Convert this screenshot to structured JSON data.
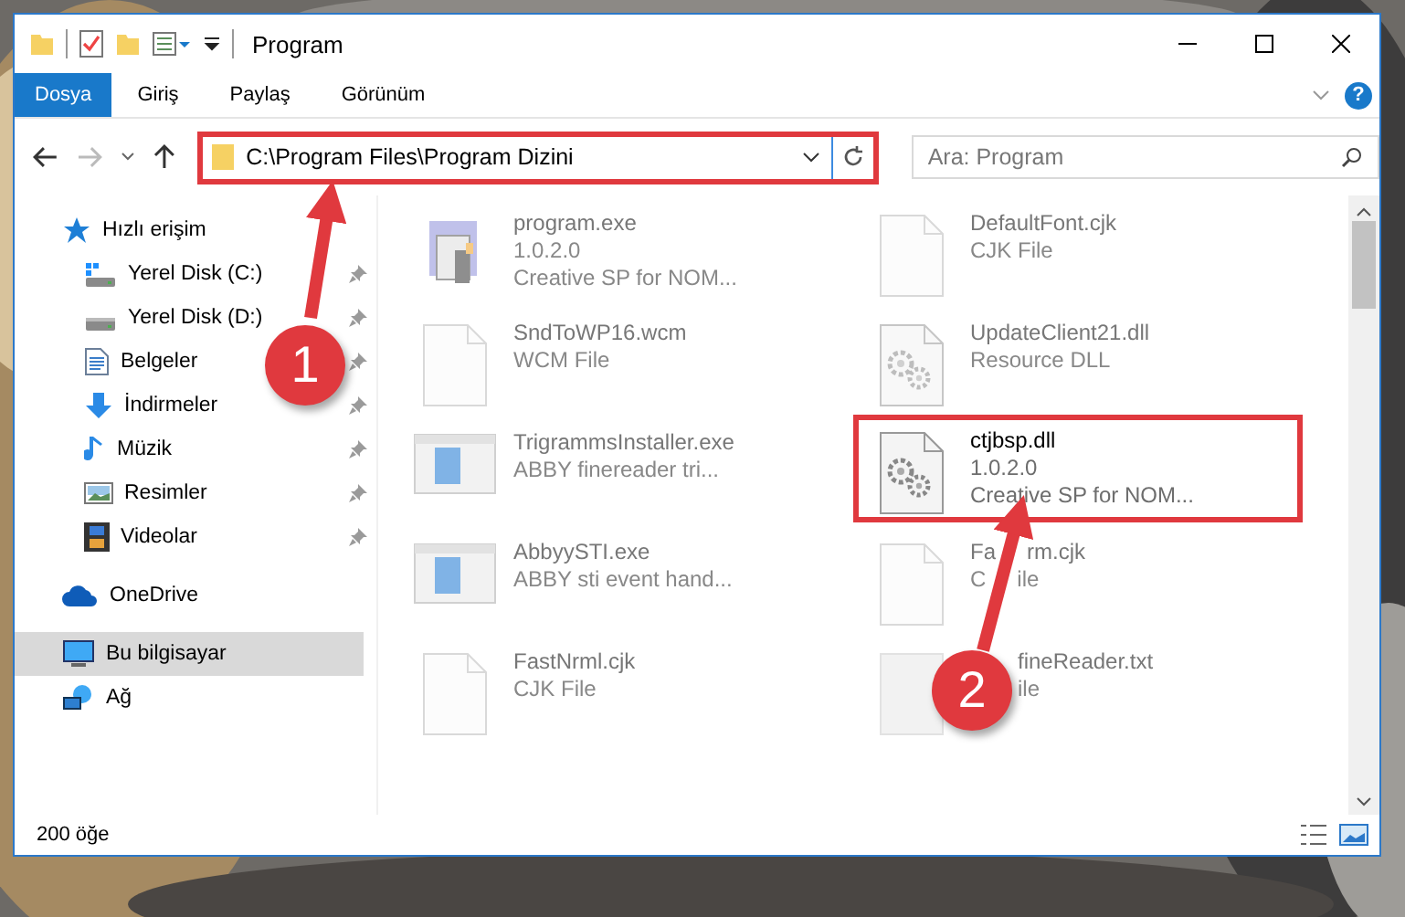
{
  "window": {
    "title": "Program"
  },
  "ribbon_tabs": [
    {
      "label": "Dosya",
      "selected": true
    },
    {
      "label": "Giriş",
      "selected": false
    },
    {
      "label": "Paylaş",
      "selected": false
    },
    {
      "label": "Görünüm",
      "selected": false
    }
  ],
  "help": "?",
  "address": {
    "value": "C:\\Program Files\\Program Dizini",
    "highlighted": true
  },
  "search": {
    "placeholder": "Ara: Program"
  },
  "sidebar": {
    "items": [
      {
        "label": "Hızlı erişim",
        "kind": "star",
        "selected": false,
        "children": [
          {
            "label": "Yerel Disk (C:)",
            "kind": "drive-c",
            "selected": false,
            "pinned": true
          },
          {
            "label": "Yerel Disk (D:)",
            "kind": "drive",
            "selected": false,
            "pinned": true
          },
          {
            "label": "Belgeler",
            "kind": "document",
            "selected": false,
            "pinned": true
          },
          {
            "label": "İndirmeler",
            "kind": "download",
            "selected": false,
            "pinned": true
          },
          {
            "label": "Müzik",
            "kind": "music",
            "selected": false,
            "pinned": true
          },
          {
            "label": "Resimler",
            "kind": "pictures",
            "selected": false,
            "pinned": true
          },
          {
            "label": "Videolar",
            "kind": "videos",
            "selected": false,
            "pinned": true
          }
        ]
      },
      {
        "label": "OneDrive",
        "kind": "cloud",
        "selected": false
      },
      {
        "label": "Bu bilgisayar",
        "kind": "computer",
        "selected": true
      },
      {
        "label": "Ağ",
        "kind": "network",
        "selected": false
      }
    ]
  },
  "files": [
    {
      "name": [
        "program.exe"
      ],
      "lines": [
        [
          "1.0.2.0"
        ],
        [
          "Creative SP for NOM..."
        ]
      ],
      "kind": "program",
      "faded": true,
      "highlighted": false
    },
    {
      "name": [
        "DefaultFont.cjk"
      ],
      "lines": [
        [
          "CJK File"
        ]
      ],
      "kind": "document",
      "faded": true,
      "highlighted": false
    },
    {
      "name": [
        "SndToWP16.wcm"
      ],
      "lines": [
        [
          "WCM File"
        ]
      ],
      "kind": "document",
      "faded": true,
      "highlighted": false
    },
    {
      "name": [
        "UpdateClient21.dll"
      ],
      "lines": [
        [
          "Resource DLL"
        ]
      ],
      "kind": "settings",
      "faded": true,
      "highlighted": false
    },
    {
      "name": [
        "TrigrammsInstaller.exe"
      ],
      "lines": [
        [
          "ABBY finereader tri..."
        ]
      ],
      "kind": "installer",
      "faded": true,
      "highlighted": false
    },
    {
      "name": [
        "ctjbsp.dll"
      ],
      "lines": [
        [
          "1.0.2.0"
        ],
        [
          "Creative SP for NOM..."
        ]
      ],
      "kind": "settings",
      "faded": false,
      "highlighted": true
    },
    {
      "name": [
        "AbbyySTI.exe"
      ],
      "lines": [
        [
          "ABBY sti event hand..."
        ]
      ],
      "kind": "installer",
      "faded": true,
      "highlighted": false
    },
    {
      "name": [
        "Fa",
        "rm.cjk"
      ],
      "lines": [
        [
          "C",
          "ile"
        ]
      ],
      "kind": "document",
      "faded": true,
      "highlighted": false
    },
    {
      "name": [
        "FastNrml.cjk"
      ],
      "lines": [
        [
          "CJK File"
        ]
      ],
      "kind": "document",
      "faded": true,
      "highlighted": false
    },
    {
      "name": [
        "fineReader.txt"
      ],
      "lines": [
        [
          "ile"
        ]
      ],
      "kind": "blank",
      "faded": true,
      "highlighted": false,
      "start_covered": true
    }
  ],
  "status_bar": {
    "count": "200 öğe"
  },
  "annotations": [
    {
      "label": "1"
    },
    {
      "label": "2"
    }
  ]
}
